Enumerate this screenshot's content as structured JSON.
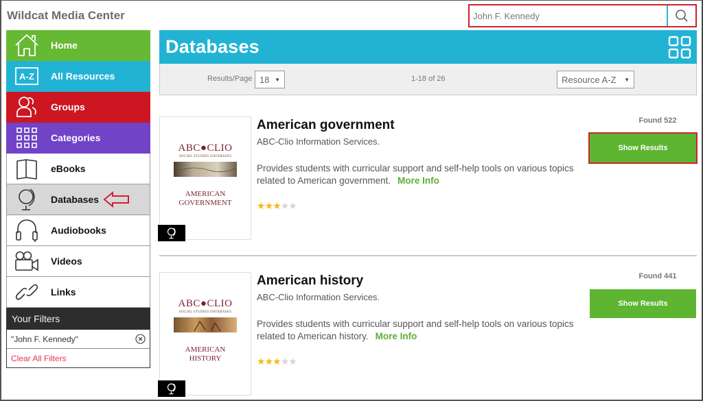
{
  "app": {
    "title": "Wildcat Media Center"
  },
  "search": {
    "value": "John F. Kennedy",
    "button_icon": "search-icon"
  },
  "sidebar": {
    "items": [
      {
        "label": "Home",
        "icon": "home-icon",
        "color": "#66b933"
      },
      {
        "label": "All Resources",
        "icon": "a-z-icon",
        "color": "#22b3d4"
      },
      {
        "label": "Groups",
        "icon": "groups-icon",
        "color": "#cc1722"
      },
      {
        "label": "Categories",
        "icon": "grid-icon",
        "color": "#7043c7"
      },
      {
        "label": "eBooks",
        "icon": "book-icon"
      },
      {
        "label": "Databases",
        "icon": "globe-icon",
        "active": true
      },
      {
        "label": "Audiobooks",
        "icon": "headphones-icon"
      },
      {
        "label": "Videos",
        "icon": "video-camera-icon"
      },
      {
        "label": "Links",
        "icon": "link-icon"
      }
    ],
    "filters": {
      "heading": "Your Filters",
      "active": [
        "\"John F. Kennedy\""
      ],
      "clear_label": "Clear All Filters"
    }
  },
  "main": {
    "heading": "Databases",
    "view_toggle_icon": "grid-view-icon",
    "toolbar": {
      "results_per_page_label": "Results/Page",
      "results_per_page_value": "18",
      "range_text": "1-18 of 26",
      "sort_value": "Resource A-Z"
    },
    "results": [
      {
        "title": "American government",
        "publisher": "ABC-Clio Information Services.",
        "description": "Provides students with curricular support and self-help tools on various topics related to American government.",
        "more_info_label": "More Info",
        "rating": 3,
        "rating_max": 5,
        "found_text": "Found 522",
        "button_label": "Show Results",
        "thumb": {
          "brand": "ABC●CLIO",
          "brand_sub": "SOCIAL STUDIES DATABASES",
          "subject_line1": "AMERICAN",
          "subject_line2": "GOVERNMENT"
        },
        "type_icon": "globe-icon"
      },
      {
        "title": "American history",
        "publisher": "ABC-Clio Information Services.",
        "description": "Provides students with curricular support and self-help tools on various topics related to American history.",
        "more_info_label": "More Info",
        "rating": 3,
        "rating_max": 5,
        "found_text": "Found 441",
        "button_label": "Show Results",
        "thumb": {
          "brand": "ABC●CLIO",
          "brand_sub": "SOCIAL STUDIES DATABASES",
          "subject_line1": "AMERICAN",
          "subject_line2": "HISTORY"
        },
        "type_icon": "globe-icon"
      }
    ]
  },
  "colors": {
    "accent_blue": "#22b3d4",
    "button_green": "#5db531",
    "annotation_red": "#d0202e",
    "star_on": "#f5b915",
    "star_off": "#d5d5d5"
  }
}
